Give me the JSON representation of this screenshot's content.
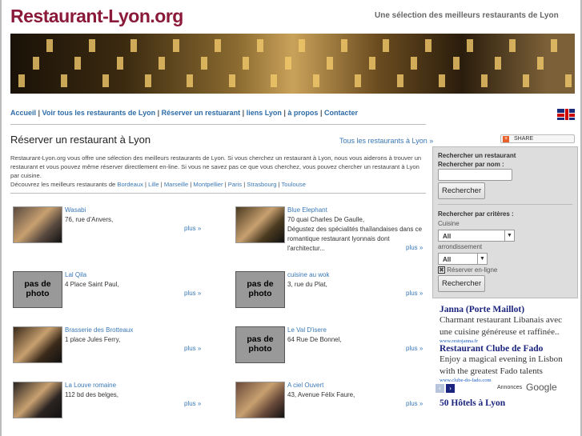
{
  "header": {
    "title": "Restaurant-Lyon.org",
    "tagline": "Une sélection des meilleurs restaurants de Lyon"
  },
  "nav": [
    {
      "label": "Accueil"
    },
    {
      "label": "Voir tous les restaurants de Lyon"
    },
    {
      "label": "Réserver un restuarant"
    },
    {
      "label": "liens Lyon"
    },
    {
      "label": "à propos"
    },
    {
      "label": "Contacter"
    }
  ],
  "main": {
    "heading": "Réserver un restaurant à Lyon",
    "all_link": "Tous les restaurants à Lyon »",
    "intro": "Restaurant-Lyon.org vous offre une sélection des meilleurs restaurants de Lyon. Si vous cherchez un restaurant à Lyon, nous vous aiderons à trouver un restaurant et vous pouvez même réserver directlement en-line. Si vous ne savez pas ce que vous cherchez, vous pouvez chercher un restaurant à Lyon par cuisine.",
    "discover": "Découvrez les meilleurs restaurants de",
    "cities": [
      "Bordeaux",
      "Lille",
      "Marseille",
      "Montpellier",
      "Paris",
      "Strasbourg",
      "Toulouse"
    ],
    "no_photo": "pas de photo",
    "more": "plus »",
    "restaurants": [
      {
        "name": "Wasabi",
        "address": "76, rue d'Anvers,",
        "photo": true,
        "bg": "#5a4a40"
      },
      {
        "name": "Blue Elephant",
        "address": "70 quai Charles De Gaulle,",
        "desc": "Dégustez des spécialités thaïlandaises dans ce romantique restaurant lyonnais dont l'architectur...",
        "photo": true,
        "bg": "#4a3a20"
      },
      {
        "name": "Lal Qila",
        "address": "4 Place Saint Paul,",
        "photo": false
      },
      {
        "name": "cuisine au wok",
        "address": "3, rue du Plat,",
        "photo": false
      },
      {
        "name": "Brasserie des Brotteaux",
        "address": "1 place Jules Ferry,",
        "photo": true,
        "bg": "#3a2a1a"
      },
      {
        "name": "Le Val D'isere",
        "address": "64 Rue De Bonnel,",
        "photo": false
      },
      {
        "name": "La Louve romaine",
        "address": "112 bd des belges,",
        "photo": true,
        "bg": "#2a2422"
      },
      {
        "name": "A ciel Ouvert",
        "address": "43, Avenue Félix Faure,",
        "photo": true,
        "bg": "#6a4a3a"
      }
    ]
  },
  "share": "SHARE",
  "search": {
    "title": "Rechercher un restaurant",
    "by_name": "Rechercher par nom :",
    "name_value": "",
    "button": "Rechercher",
    "by_criteria": "Rechercher par critères :",
    "cuisine_label": "Cuisine",
    "cuisine_value": "All",
    "arr_label": "arrondissement",
    "arr_value": "All",
    "online_label": "Réserver en-ligne",
    "online_checked": true
  },
  "ads": [
    {
      "title": "Janna (Porte Maillot)",
      "body": "Charmant restaurant Libanais avec une cuisine généreuse et raffinée..",
      "url": "www.restojanna.fr"
    },
    {
      "title": "Restaurant Clube de Fado",
      "body": "Enjoy a magical evening in Lisbon with the greatest Fado talents",
      "url": "www.clube-do-fado.com"
    }
  ],
  "ads_label": "Annonces",
  "ads_brand": "Google",
  "ad_next_title": "50 Hôtels à Lyon"
}
